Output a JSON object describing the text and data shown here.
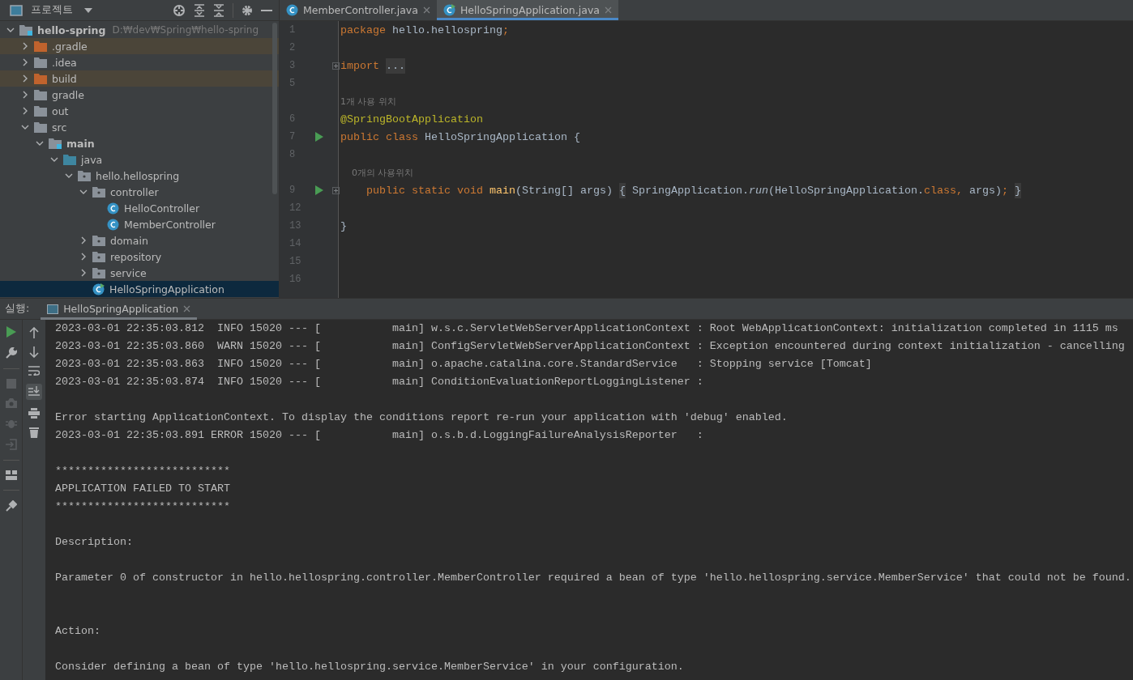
{
  "project_panel": {
    "title": "프로젝트",
    "tree": [
      {
        "label": "hello-spring",
        "path": "D:₩dev₩Spring₩hello-spring",
        "kind": "module",
        "bold": true,
        "expanded": true,
        "selected": false,
        "children": [
          {
            "label": ".gradle",
            "kind": "excluded",
            "expanded": false,
            "selected": false
          },
          {
            "label": ".idea",
            "kind": "folder",
            "expanded": false,
            "selected": false
          },
          {
            "label": "build",
            "kind": "excluded",
            "expanded": false,
            "selected": false
          },
          {
            "label": "gradle",
            "kind": "folder",
            "expanded": false,
            "selected": false
          },
          {
            "label": "out",
            "kind": "folder",
            "expanded": false,
            "selected": false
          },
          {
            "label": "src",
            "kind": "folder",
            "expanded": true,
            "selected": false,
            "children": [
              {
                "label": "main",
                "kind": "module",
                "bold": true,
                "expanded": true,
                "selected": false,
                "children": [
                  {
                    "label": "java",
                    "kind": "source",
                    "expanded": true,
                    "selected": false,
                    "children": [
                      {
                        "label": "hello.hellospring",
                        "kind": "package",
                        "expanded": true,
                        "selected": false,
                        "children": [
                          {
                            "label": "controller",
                            "kind": "package",
                            "expanded": true,
                            "selected": false,
                            "children": [
                              {
                                "label": "HelloController",
                                "kind": "class",
                                "selected": false
                              },
                              {
                                "label": "MemberController",
                                "kind": "class",
                                "selected": false
                              }
                            ]
                          },
                          {
                            "label": "domain",
                            "kind": "package",
                            "expanded": false,
                            "selected": false
                          },
                          {
                            "label": "repository",
                            "kind": "package",
                            "expanded": false,
                            "selected": false
                          },
                          {
                            "label": "service",
                            "kind": "package",
                            "expanded": false,
                            "selected": false
                          },
                          {
                            "label": "HelloSpringApplication",
                            "kind": "app",
                            "selected": true
                          }
                        ]
                      }
                    ]
                  }
                ]
              }
            ]
          }
        ]
      }
    ]
  },
  "editor": {
    "tabs": [
      {
        "label": "MemberController.java",
        "kind": "class",
        "selected": false
      },
      {
        "label": "HelloSpringApplication.java",
        "kind": "app",
        "selected": true
      }
    ],
    "lines": [
      {
        "number": "1",
        "tokens": [
          {
            "kind": "keyword",
            "text": "package "
          },
          {
            "kind": "plain",
            "text": "hello.hellospring"
          },
          {
            "kind": "keyword",
            "text": ";"
          }
        ]
      },
      {
        "number": "2"
      },
      {
        "number": "3",
        "fold": true,
        "tokens": [
          {
            "kind": "keyword",
            "text": "import "
          },
          {
            "kind": "folded",
            "text": "..."
          }
        ]
      },
      {
        "number": "5"
      },
      {
        "kind": "hint",
        "text": "1개 사용 위치"
      },
      {
        "number": "6",
        "tokens": [
          {
            "kind": "annotation",
            "text": "@SpringBootApplication"
          }
        ]
      },
      {
        "number": "7",
        "run": true,
        "tokens": [
          {
            "kind": "keyword",
            "text": "public class "
          },
          {
            "kind": "plain",
            "text": "HelloSpringApplication {"
          }
        ]
      },
      {
        "number": "8"
      },
      {
        "kind": "hint",
        "text": "    0개의 사용위치"
      },
      {
        "number": "9",
        "run": true,
        "fold": true,
        "tokens": [
          {
            "kind": "keyword",
            "text": "    public static void "
          },
          {
            "kind": "method",
            "text": "main"
          },
          {
            "kind": "plain",
            "text": "(String[] args) "
          },
          {
            "kind": "folded",
            "text": "{"
          },
          {
            "kind": "plain",
            "text": " SpringApplication."
          },
          {
            "kind": "italic",
            "text": "run"
          },
          {
            "kind": "plain",
            "text": "(HelloSpringApplication."
          },
          {
            "kind": "keyword",
            "text": "class, "
          },
          {
            "kind": "plain",
            "text": "args)"
          },
          {
            "kind": "keyword",
            "text": "; "
          },
          {
            "kind": "folded",
            "text": "}"
          }
        ]
      },
      {
        "number": "12"
      },
      {
        "number": "13",
        "tokens": [
          {
            "kind": "plain",
            "text": "}"
          }
        ]
      },
      {
        "number": "14"
      },
      {
        "number": "15"
      },
      {
        "number": "16"
      }
    ]
  },
  "run_panel": {
    "label": "실행:",
    "tab": {
      "label": "HelloSpringApplication",
      "selected": true
    },
    "console": [
      {
        "kind": "text",
        "text": "2023-03-01 22:35:03.812  INFO 15020 --- [           main] w.s.c.ServletWebServerApplicationContext : Root WebApplicationContext: initialization completed in 1115 ms"
      },
      {
        "kind": "text",
        "text": "2023-03-01 22:35:03.860  WARN 15020 --- [           main] ConfigServletWebServerApplicationContext : Exception encountered during context initialization - cancelling"
      },
      {
        "kind": "text",
        "text": "2023-03-01 22:35:03.863  INFO 15020 --- [           main] o.apache.catalina.core.StandardService   : Stopping service [Tomcat]"
      },
      {
        "kind": "text",
        "text": "2023-03-01 22:35:03.874  INFO 15020 --- [           main] ConditionEvaluationReportLoggingListener :"
      },
      {
        "kind": "blank"
      },
      {
        "kind": "text",
        "text": "Error starting ApplicationContext. To display the conditions report re-run your application with 'debug' enabled."
      },
      {
        "kind": "text",
        "text": "2023-03-01 22:35:03.891 ERROR 15020 --- [           main] o.s.b.d.LoggingFailureAnalysisReporter   :"
      },
      {
        "kind": "blank"
      },
      {
        "kind": "text",
        "text": "***************************"
      },
      {
        "kind": "text",
        "text": "APPLICATION FAILED TO START"
      },
      {
        "kind": "text",
        "text": "***************************"
      },
      {
        "kind": "blank"
      },
      {
        "kind": "text",
        "text": "Description:"
      },
      {
        "kind": "blank"
      },
      {
        "kind": "text",
        "text": "Parameter 0 of constructor in hello.hellospring.controller.MemberController required a bean of type 'hello.hellospring.service.MemberService' that could not be found."
      },
      {
        "kind": "blank"
      },
      {
        "kind": "blank"
      },
      {
        "kind": "text",
        "text": "Action:"
      },
      {
        "kind": "blank"
      },
      {
        "kind": "text",
        "text": "Consider defining a bean of type 'hello.hellospring.service.MemberService' in your configuration."
      }
    ]
  }
}
